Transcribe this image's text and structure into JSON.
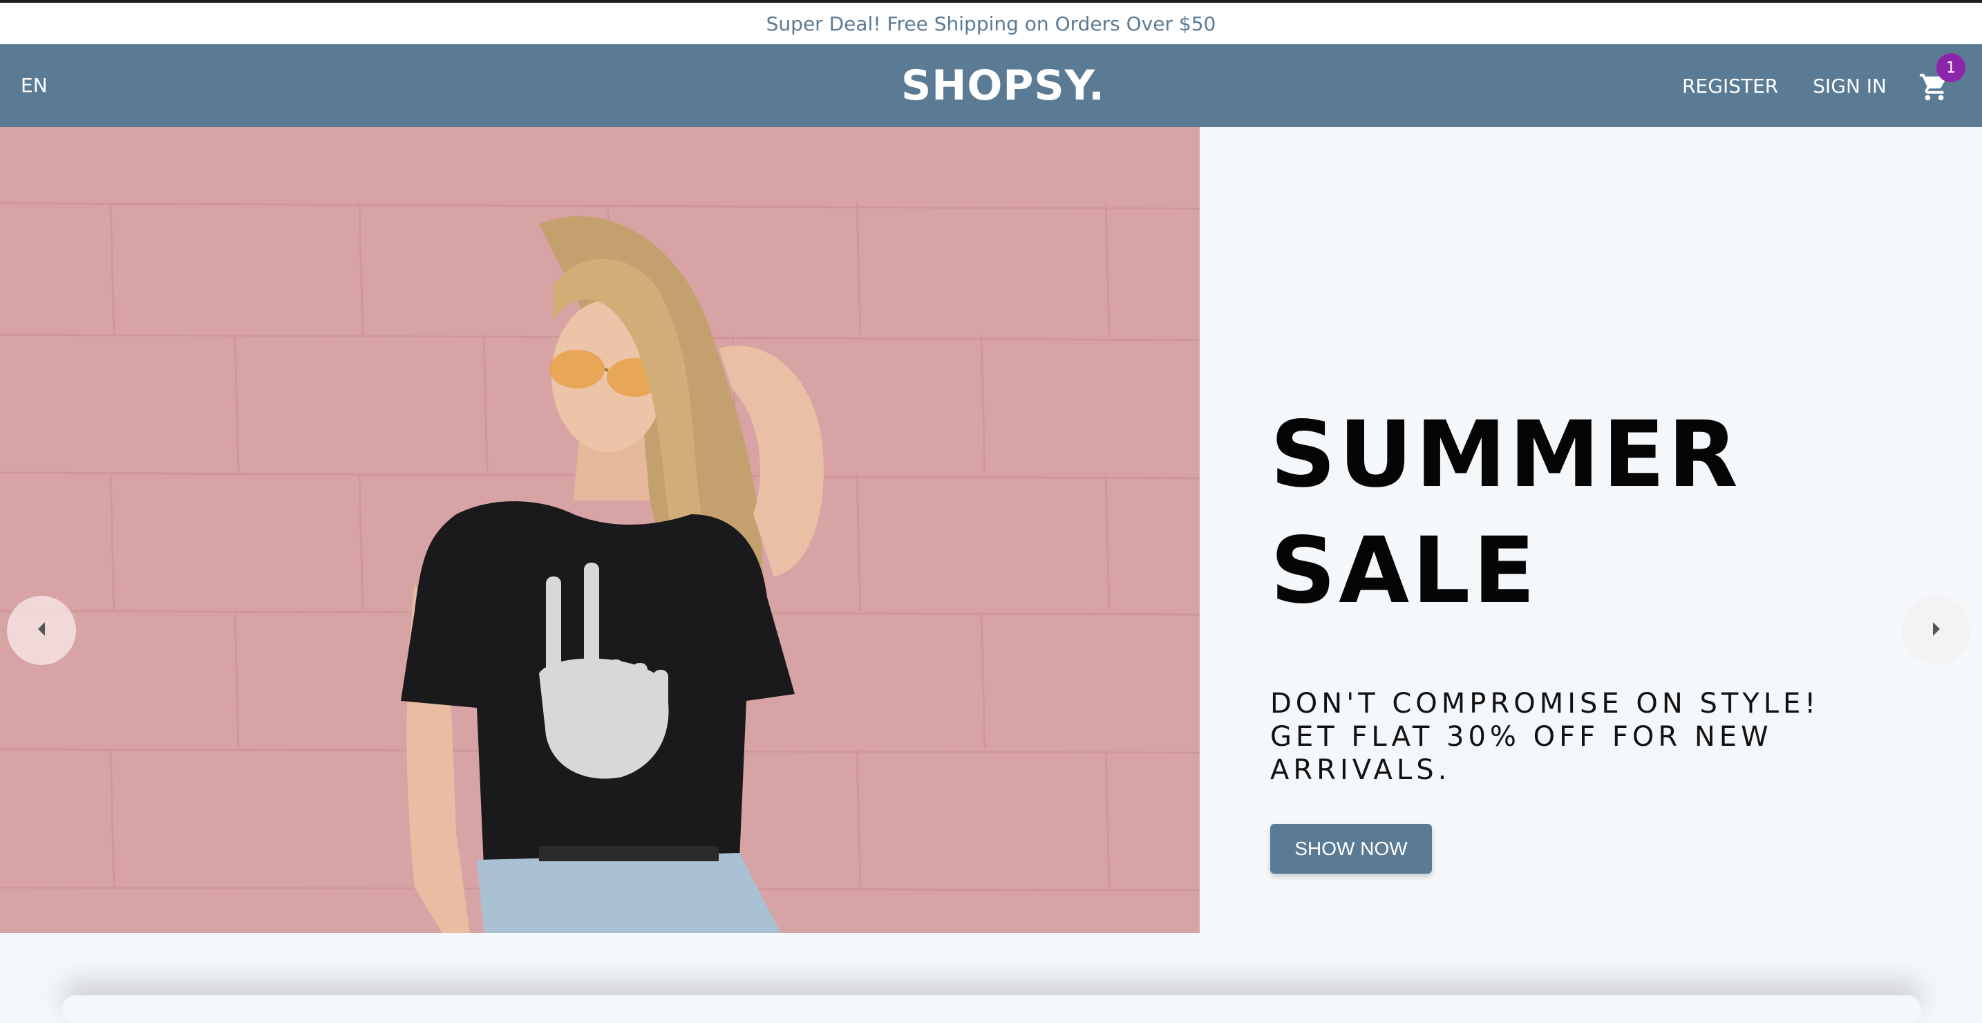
{
  "announcement": {
    "text": "Super Deal! Free Shipping on Orders Over $50"
  },
  "navbar": {
    "language": "EN",
    "logo": "SHOPSY.",
    "register_label": "REGISTER",
    "signin_label": "SIGN IN",
    "cart_count": "1",
    "cart_icon": "shopping-cart-icon"
  },
  "hero": {
    "title_line1": "SUMMER",
    "title_line2": "SALE",
    "description": "DON'T COMPROMISE ON STYLE! GET FLAT 30% OFF FOR NEW ARRIVALS.",
    "button_label": "SHOW NOW",
    "image": "model-in-skeleton-peace-tshirt-photo",
    "prev_icon": "caret-left-icon",
    "next_icon": "caret-right-icon"
  },
  "colors": {
    "primary": "#5b7b94",
    "badge": "#8e24aa",
    "announcement_text": "#5a7b96",
    "page_bg": "#f5f8fb",
    "hero_photo_bg": "#d9a2a3"
  }
}
